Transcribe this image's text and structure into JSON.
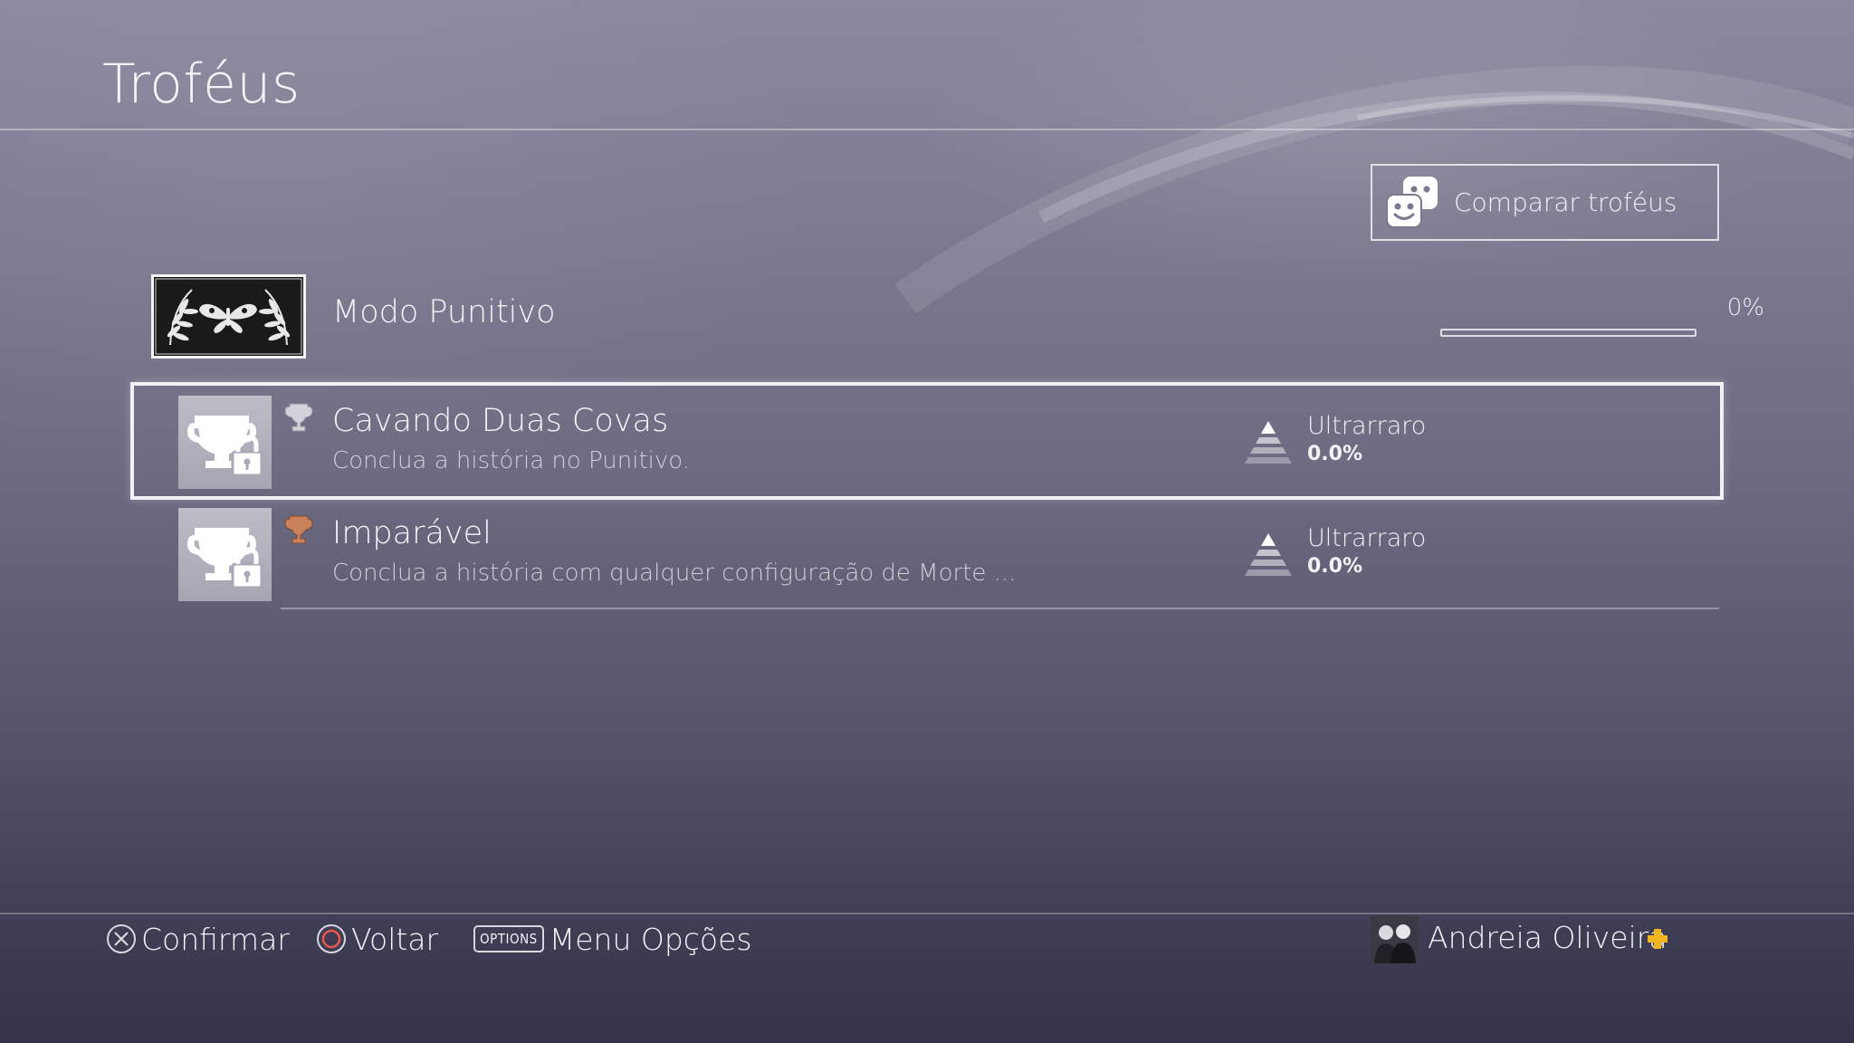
{
  "header": {
    "title": "Troféus"
  },
  "compare": {
    "label": "Comparar troféus",
    "icon": "friends-compare-icon"
  },
  "game": {
    "name": "Modo Punitivo",
    "progress_label": "0%",
    "progress_value": 0,
    "thumbnail_icon": "moth-laurel-emblem"
  },
  "trophies": [
    {
      "name": "Cavando Duas Covas",
      "description": "Conclua a história no Punitivo.",
      "grade": "silver",
      "grade_color": "#c7c7cf",
      "locked": true,
      "rarity_label": "Ultrarraro",
      "rarity_pct": "0.0%",
      "selected": true
    },
    {
      "name": "Imparável",
      "description": "Conclua a história com qualquer configuração de Morte ...",
      "grade": "bronze",
      "grade_color": "#c9825a",
      "locked": true,
      "rarity_label": "Ultrarraro",
      "rarity_pct": "0.0%",
      "selected": false
    }
  ],
  "footer": {
    "confirm_label": "Confirmar",
    "back_label": "Voltar",
    "options_key": "OPTIONS",
    "options_label": "Menu Opções",
    "user_name": "Andreia Oliveira",
    "plus_color": "#f2b51d"
  }
}
